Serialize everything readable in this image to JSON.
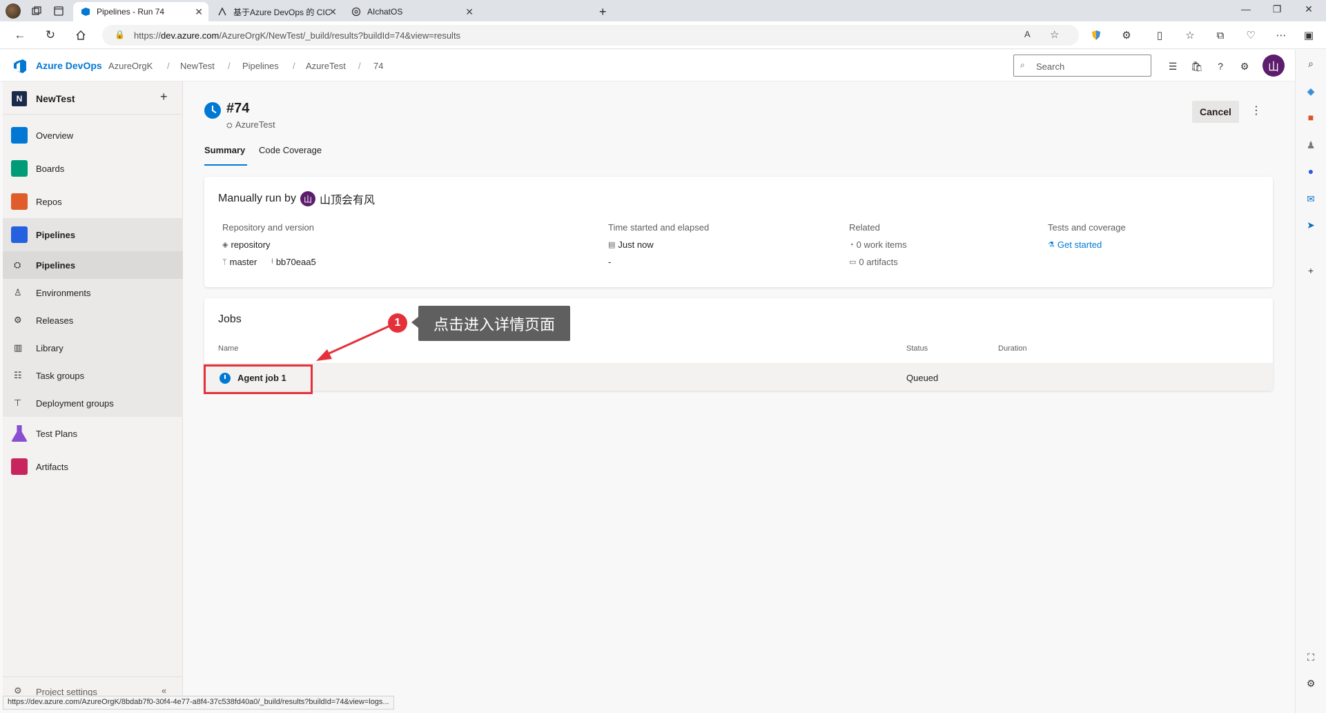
{
  "browser": {
    "tabs": [
      {
        "title": "Pipelines - Run 74",
        "active": true,
        "icon": "azure-devops-icon"
      },
      {
        "title": "基于Azure DevOps 的 CICD 项目",
        "active": false,
        "icon": "document-icon"
      },
      {
        "title": "AIchatOS",
        "active": false,
        "icon": "openai-icon"
      }
    ],
    "new_tab": "+",
    "url_prefix": "https://",
    "url_host": "dev.azure.com",
    "url_path": "/AzureOrgK/NewTest/_build/results?buildId=74&view=results",
    "status_url": "https://dev.azure.com/AzureOrgK/8bdab7f0-30f4-4e77-a8f4-37c538fd40a0/_build/results?buildId=74&view=logs..."
  },
  "header": {
    "brand": "Azure DevOps",
    "breadcrumbs": [
      "AzureOrgK",
      "NewTest",
      "Pipelines",
      "AzureTest",
      "74"
    ],
    "search_placeholder": "Search",
    "user_initial": "山"
  },
  "sidebar": {
    "project_initial": "N",
    "project_name": "NewTest",
    "add_symbol": "+",
    "items": [
      {
        "label": "Overview",
        "icon": "overview-icon",
        "color": "#0078d4"
      },
      {
        "label": "Boards",
        "icon": "boards-icon",
        "color": "#009b77"
      },
      {
        "label": "Repos",
        "icon": "repos-icon",
        "color": "#e05c2b"
      },
      {
        "label": "Pipelines",
        "icon": "pipelines-icon",
        "color": "#2560e0"
      }
    ],
    "sub_items": [
      {
        "label": "Pipelines",
        "icon": "pipelines-sub-icon"
      },
      {
        "label": "Environments",
        "icon": "environments-icon"
      },
      {
        "label": "Releases",
        "icon": "releases-icon"
      },
      {
        "label": "Library",
        "icon": "library-icon"
      },
      {
        "label": "Task groups",
        "icon": "task-groups-icon"
      },
      {
        "label": "Deployment groups",
        "icon": "deployment-groups-icon"
      }
    ],
    "items_after": [
      {
        "label": "Test Plans",
        "icon": "test-plans-icon",
        "color": "#8a4fd0"
      },
      {
        "label": "Artifacts",
        "icon": "artifacts-icon",
        "color": "#c8245e"
      }
    ],
    "bottom_label": "Project settings",
    "collapse_symbol": "«"
  },
  "run": {
    "number": "#74",
    "pipeline": "AzureTest",
    "cancel_label": "Cancel",
    "more_symbol": "⋮",
    "tabs": [
      "Summary",
      "Code Coverage"
    ]
  },
  "summary": {
    "title_prefix": "Manually run by",
    "user_initial": "山",
    "user_name": "山顶会有风",
    "repo_label": "Repository and version",
    "repo_name": "repository",
    "branch": "master",
    "commit": "bb70eaa5",
    "time_label": "Time started and elapsed",
    "time_value": "Just now",
    "elapsed": "-",
    "related_label": "Related",
    "work_items": "0 work items",
    "artifacts": "0 artifacts",
    "tests_label": "Tests and coverage",
    "tests_link": "Get started"
  },
  "jobs": {
    "title": "Jobs",
    "col_name": "Name",
    "col_status": "Status",
    "col_duration": "Duration",
    "rows": [
      {
        "name": "Agent job 1",
        "status": "Queued",
        "duration": ""
      }
    ]
  },
  "annotation": {
    "number": "1",
    "text": "点击进入详情页面",
    "color": "#e5303a"
  }
}
